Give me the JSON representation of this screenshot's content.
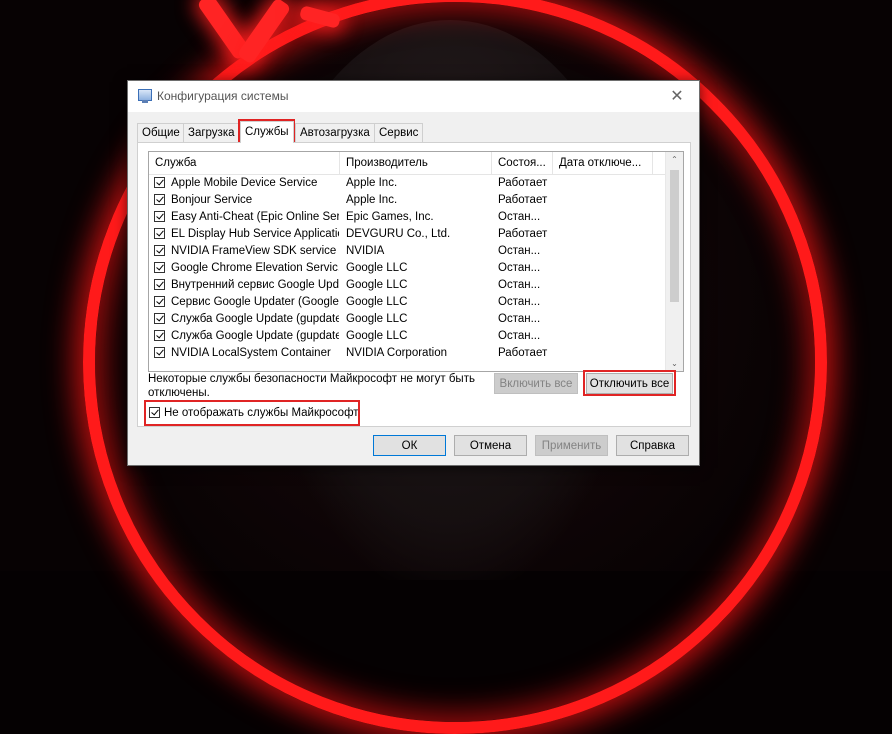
{
  "window": {
    "title": "Конфигурация системы",
    "close_glyph": "✕",
    "icon": "msconfig-icon"
  },
  "tabs": [
    {
      "label": "Общие",
      "active": false
    },
    {
      "label": "Загрузка",
      "active": false
    },
    {
      "label": "Службы",
      "active": true
    },
    {
      "label": "Автозагрузка",
      "active": false
    },
    {
      "label": "Сервис",
      "active": false
    }
  ],
  "columns": [
    "Служба",
    "Производитель",
    "Состоя...",
    "Дата отключе..."
  ],
  "services": [
    {
      "name": "Apple Mobile Device Service",
      "vendor": "Apple Inc.",
      "status": "Работает",
      "date": "",
      "checked": true
    },
    {
      "name": "Bonjour Service",
      "vendor": "Apple Inc.",
      "status": "Работает",
      "date": "",
      "checked": true
    },
    {
      "name": "Easy Anti-Cheat (Epic Online Ser...",
      "vendor": "Epic Games, Inc.",
      "status": "Остан...",
      "date": "",
      "checked": true
    },
    {
      "name": "EL Display Hub Service Application",
      "vendor": "DEVGURU Co., Ltd.",
      "status": "Работает",
      "date": "",
      "checked": true
    },
    {
      "name": "NVIDIA FrameView SDK service",
      "vendor": "NVIDIA",
      "status": "Остан...",
      "date": "",
      "checked": true
    },
    {
      "name": "Google Chrome Elevation Servic...",
      "vendor": "Google LLC",
      "status": "Остан...",
      "date": "",
      "checked": true
    },
    {
      "name": "Внутренний сервис Google Upd...",
      "vendor": "Google LLC",
      "status": "Остан...",
      "date": "",
      "checked": true
    },
    {
      "name": "Сервис Google Updater (Google...",
      "vendor": "Google LLC",
      "status": "Остан...",
      "date": "",
      "checked": true
    },
    {
      "name": "Служба Google Update (gupdate)",
      "vendor": "Google LLC",
      "status": "Остан...",
      "date": "",
      "checked": true
    },
    {
      "name": "Служба Google Update (gupdatem)",
      "vendor": "Google LLC",
      "status": "Остан...",
      "date": "",
      "checked": true
    },
    {
      "name": "NVIDIA LocalSystem Container",
      "vendor": "NVIDIA Corporation",
      "status": "Работает",
      "date": "",
      "checked": true
    }
  ],
  "scrollbar": {
    "up": "⌃",
    "down": "⌄"
  },
  "note": "Некоторые службы безопасности Майкрософт не могут быть отключены.",
  "buttons": {
    "enable_all": "Включить все",
    "disable_all": "Отключить все",
    "ok": "ОК",
    "cancel": "Отмена",
    "apply": "Применить",
    "help": "Справка"
  },
  "hide_ms": {
    "label": "Не отображать службы Майкрософт",
    "checked": true
  },
  "highlight_color": "#e02424",
  "accent_color": "#ff1a1a"
}
